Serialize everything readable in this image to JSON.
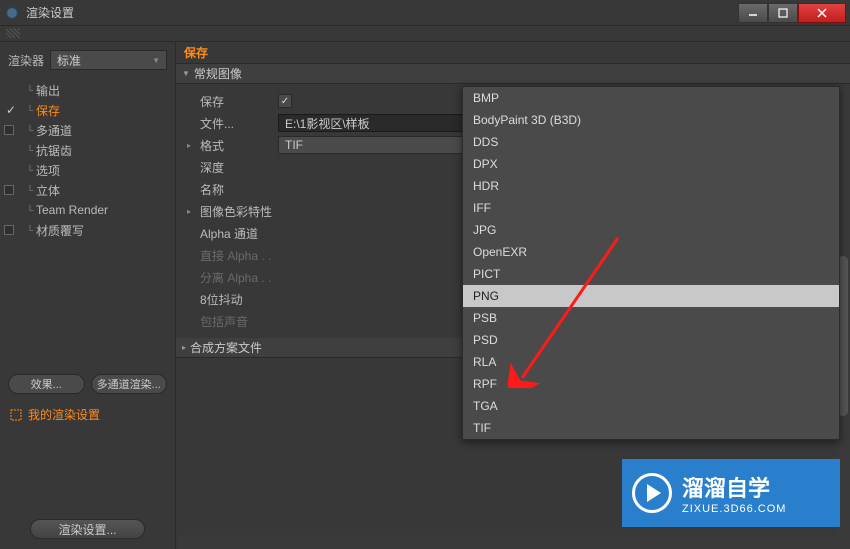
{
  "title": "渲染设置",
  "renderer": {
    "label": "渲染器",
    "value": "标准"
  },
  "tree": {
    "output": "输出",
    "save": "保存",
    "multipass": "多通道",
    "antialias": "抗锯齿",
    "options": "选项",
    "stereo": "立体",
    "team_render": "Team Render",
    "material_override": "材质覆写"
  },
  "buttons": {
    "effect": "效果...",
    "multipass_render": "多通道渲染...",
    "my_render_settings": "我的渲染设置",
    "render_settings": "渲染设置..."
  },
  "panel": {
    "tab_save": "保存",
    "section_regular": "常规图像",
    "save_label": "保存",
    "file_label": "文件...",
    "file_value": "E:\\1影视区\\样板",
    "format_label": "格式",
    "format_value": "TIF",
    "depth_label": "深度",
    "name_label": "名称",
    "colorprofile_label": "图像色彩特性",
    "alpha_label": "Alpha 通道",
    "straight_alpha": "直接 Alpha . .",
    "separate_alpha": "分离 Alpha . .",
    "dither_label": "8位抖动",
    "include_sound": "包括声音",
    "section_compose": "合成方案文件"
  },
  "dropdown": [
    "BMP",
    "BodyPaint 3D (B3D)",
    "DDS",
    "DPX",
    "HDR",
    "IFF",
    "JPG",
    "OpenEXR",
    "PICT",
    "PNG",
    "PSB",
    "PSD",
    "RLA",
    "RPF",
    "TGA",
    "TIF"
  ],
  "dropdown_hover_index": 9,
  "watermark": {
    "main": "溜溜自学",
    "sub": "ZIXUE.3D66.COM"
  }
}
